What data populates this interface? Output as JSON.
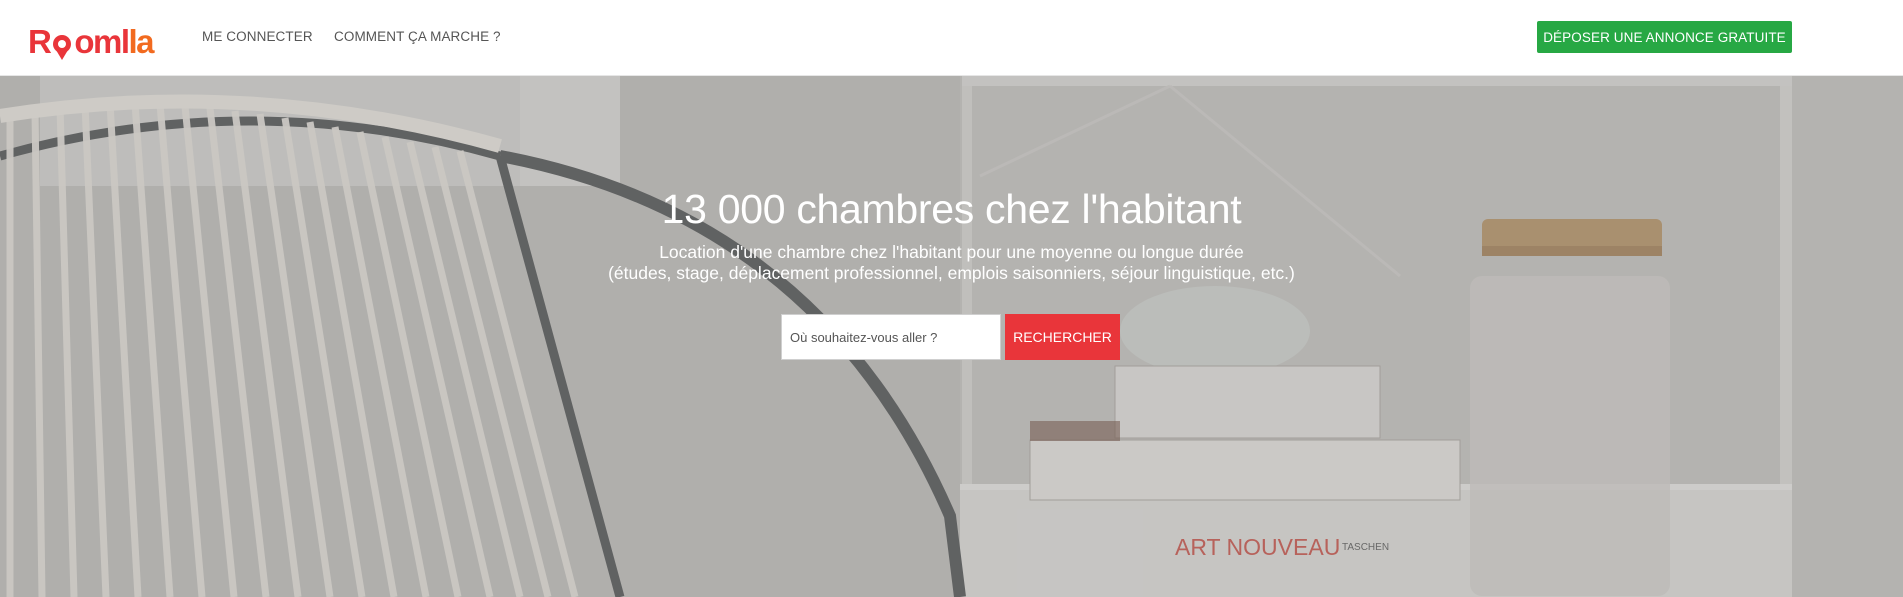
{
  "header": {
    "logo": {
      "part1": "R",
      "part2": "oml",
      "part3": "la"
    },
    "nav": {
      "login": "ME CONNECTER",
      "how": "COMMENT ÇA MARCHE ?"
    },
    "cta": "DÉPOSER UNE ANNONCE GRATUITE"
  },
  "hero": {
    "title": "13 000 chambres chez l'habitant",
    "subtitle_line1": "Location d'une chambre chez l'habitant pour une moyenne ou longue durée",
    "subtitle_line2": "(études, stage, déplacement professionnel, emplois saisonniers, séjour linguistique, etc.)",
    "search": {
      "placeholder": "Où souhaitez-vous aller ?",
      "value": "",
      "button": "RECHERCHER"
    },
    "background_books": {
      "book_title": "ART NOUVEAU",
      "publisher": "TASCHEN"
    }
  },
  "colors": {
    "brand_red": "#e9353a",
    "brand_orange": "#f26a1f",
    "cta_green": "#27a844"
  }
}
